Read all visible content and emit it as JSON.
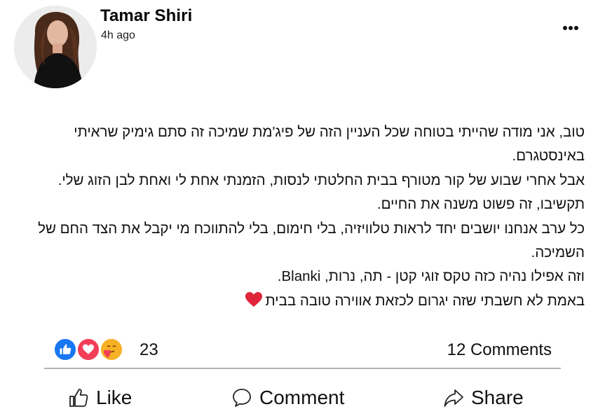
{
  "post": {
    "author": "Tamar Shiri",
    "time": "4h ago",
    "body": {
      "line1": "טוב, אני מודה שהייתי בטוחה שכל העניין הזה של פיג'מת שמיכה זה סתם גימיק שראיתי באינסטגרם.",
      "line2": "אבל אחרי שבוע של קור מטורף בבית החלטתי לנסות, הזמנתי אחת לי ואחת לבן הזוג שלי.",
      "line3": "תקשיבו, זה פשוט משנה את החיים.",
      "line4": "כל ערב אנחנו יושבים יחד לראות טלוויזיה, בלי חימום, בלי להתווכח מי יקבל את הצד החם של השמיכה.",
      "line5": "וזה אפילו נהיה כזה טקס זוגי קטן - תה, נרות, Blanki.",
      "line6": "באמת לא חשבתי שזה יגרום לכזאת אווירה טובה בבית"
    }
  },
  "reactions": {
    "icons": [
      "like-icon",
      "love-icon",
      "care-icon"
    ],
    "count": "23",
    "comments": "12 Comments"
  },
  "actions": {
    "like": "Like",
    "comment": "Comment",
    "share": "Share"
  },
  "colors": {
    "like_blue": "#1877f2",
    "love_red": "#f33e58",
    "care_yellow": "#f7b125",
    "heart_emoji": "#e0243a"
  }
}
